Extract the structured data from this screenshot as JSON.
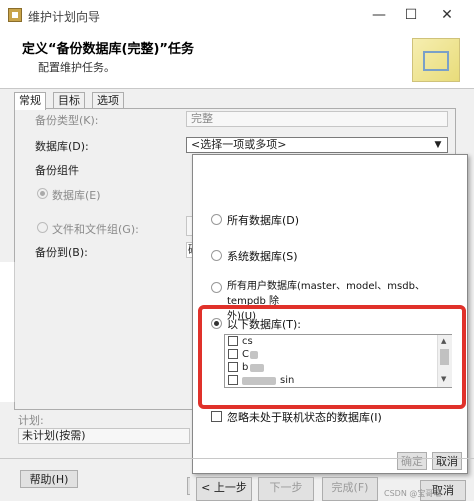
{
  "window": {
    "title": "维护计划向导",
    "minimize": "—",
    "maximize": "☐",
    "close": "✕"
  },
  "header": {
    "title": "定义“备份数据库(完整)”任务",
    "subtitle": "配置维护任务。"
  },
  "tabs": [
    {
      "label": "常规",
      "active": true
    },
    {
      "label": "目标",
      "active": false
    },
    {
      "label": "选项",
      "active": false
    }
  ],
  "form": {
    "backup_type_label": "备份类型(K):",
    "backup_type_value": "完整",
    "database_label": "数据库(D):",
    "database_value": "<选择一项或多项>",
    "backup_component_label": "备份组件",
    "radio_database_label": "数据库(E)",
    "radio_files_label": "文件和文件组(G):",
    "backup_to_label": "备份到(B):",
    "backup_to_value": "磁"
  },
  "popup": {
    "opt_all": "所有数据库(D)",
    "opt_system": "系统数据库(S)",
    "opt_user_line1": "所有用户数据库(master、model、msdb、tempdb 除",
    "opt_user_line2": "外)(U)",
    "opt_these": "以下数据库(T):",
    "databases": [
      {
        "name": "cs",
        "checked": false
      },
      {
        "name": "C",
        "checked": false
      },
      {
        "name": "b",
        "checked": false
      },
      {
        "name": "sin",
        "checked": false
      }
    ],
    "ignore_offline_label": "忽略未处于联机状态的数据库(I)",
    "ok_label": "确定",
    "cancel_label": "取消"
  },
  "bottom": {
    "schedule_label": "计划:",
    "schedule_value": "未计划(按需)",
    "help_label": "帮助(H)",
    "back_label": "< 上一步",
    "next_label": "下一步",
    "finish_label": "完成(F)",
    "cancel_label": "取消"
  },
  "watermark": "CSDN @宝哥嘻"
}
